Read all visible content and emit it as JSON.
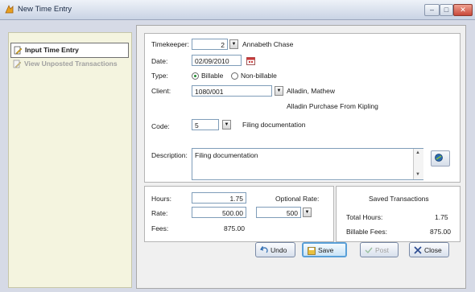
{
  "window": {
    "title": "New Time Entry",
    "min": "–",
    "max": "□",
    "close": "✕"
  },
  "sidebar": {
    "items": [
      {
        "label": "Input Time Entry",
        "icon": "time-entry-icon",
        "active": true
      },
      {
        "label": "View Unposted Transactions",
        "icon": "transactions-icon",
        "active": false
      }
    ]
  },
  "form": {
    "timekeeper": {
      "label": "Timekeeper:",
      "value": "2",
      "name": "Annabeth Chase"
    },
    "date": {
      "label": "Date:",
      "value": "02/09/2010"
    },
    "type": {
      "label": "Type:",
      "options": [
        "Billable",
        "Non-billable"
      ],
      "selected": "Billable"
    },
    "client": {
      "label": "Client:",
      "value": "1080/001",
      "name": "Alladin, Mathew",
      "matter": "Alladin Purchase From Kipling"
    },
    "code": {
      "label": "Code:",
      "value": "5",
      "desc": "Filing documentation"
    },
    "description": {
      "label": "Description:",
      "value": "Filing documentation"
    }
  },
  "amounts": {
    "hours": {
      "label": "Hours:",
      "value": "1.75"
    },
    "rate": {
      "label": "Rate:",
      "value": "500.00"
    },
    "optional_rate": {
      "label": "Optional Rate:",
      "value": "500"
    },
    "fees": {
      "label": "Fees:",
      "value": "875.00"
    }
  },
  "saved": {
    "title": "Saved Transactions",
    "total_hours_label": "Total Hours:",
    "total_hours": "1.75",
    "billable_fees_label": "Billable Fees:",
    "billable_fees": "875.00"
  },
  "buttons": {
    "undo": "Undo",
    "save": "Save",
    "post": "Post",
    "close": "Close"
  },
  "colors": {
    "accent": "#5aa0d8",
    "sidebar_bg": "#f4f4df",
    "selected_radio": "#1e8a2e",
    "close_icon": "#c8483a"
  }
}
